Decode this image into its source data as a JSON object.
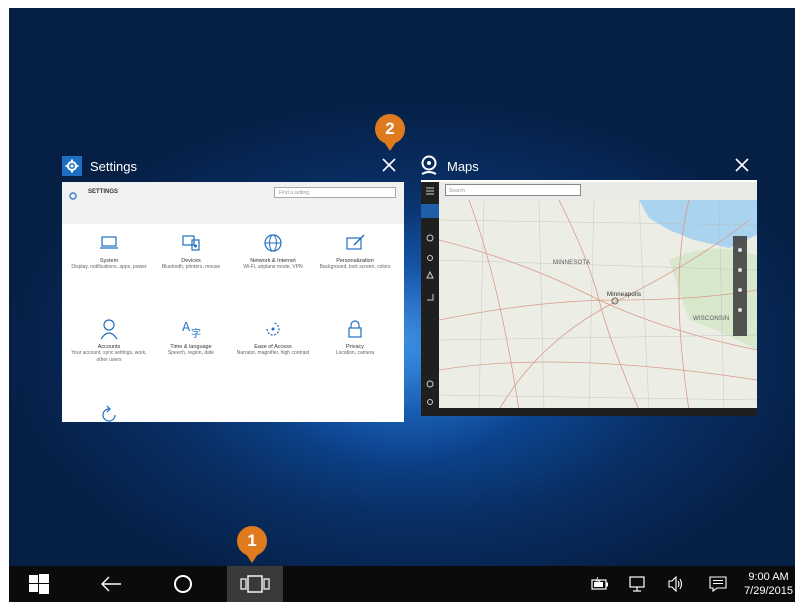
{
  "windows": [
    {
      "title": "Settings",
      "icon": "gear-icon"
    },
    {
      "title": "Maps",
      "icon": "maps-pin-icon"
    }
  ],
  "settings_app": {
    "heading": "SETTINGS",
    "search_placeholder": "Find a setting",
    "items": [
      {
        "name": "System",
        "desc": "Display, notifications, apps, power",
        "icon": "laptop-icon"
      },
      {
        "name": "Devices",
        "desc": "Bluetooth, printers, mouse",
        "icon": "devices-icon"
      },
      {
        "name": "Network & Internet",
        "desc": "Wi-Fi, airplane mode, VPN",
        "icon": "globe-icon"
      },
      {
        "name": "Personalization",
        "desc": "Background, lock screen, colors",
        "icon": "paint-icon"
      },
      {
        "name": "Accounts",
        "desc": "Your account, sync settings, work, other users",
        "icon": "person-icon"
      },
      {
        "name": "Time & language",
        "desc": "Speech, region, date",
        "icon": "language-icon"
      },
      {
        "name": "Ease of Access",
        "desc": "Narrator, magnifier, high contrast",
        "icon": "ease-of-access-icon"
      },
      {
        "name": "Privacy",
        "desc": "Location, camera",
        "icon": "lock-icon"
      }
    ]
  },
  "maps_app": {
    "search_placeholder": "Search",
    "map_labels": [
      "MINNESOTA",
      "Minneapolis",
      "WISCONSIN"
    ]
  },
  "callouts": {
    "one": "1",
    "two": "2"
  },
  "taskbar": {
    "buttons": [
      "windows-start-icon",
      "back-arrow-icon",
      "cortana-circle-icon",
      "task-view-icon"
    ],
    "tray": [
      "battery-icon",
      "network-icon",
      "volume-icon",
      "action-center-icon"
    ],
    "time": "9:00 AM",
    "date": "7/29/2015"
  },
  "colors": {
    "callout": "#e07a1f",
    "taskbar": "#0b0b0b",
    "settings_accent": "#1e6fc1"
  }
}
